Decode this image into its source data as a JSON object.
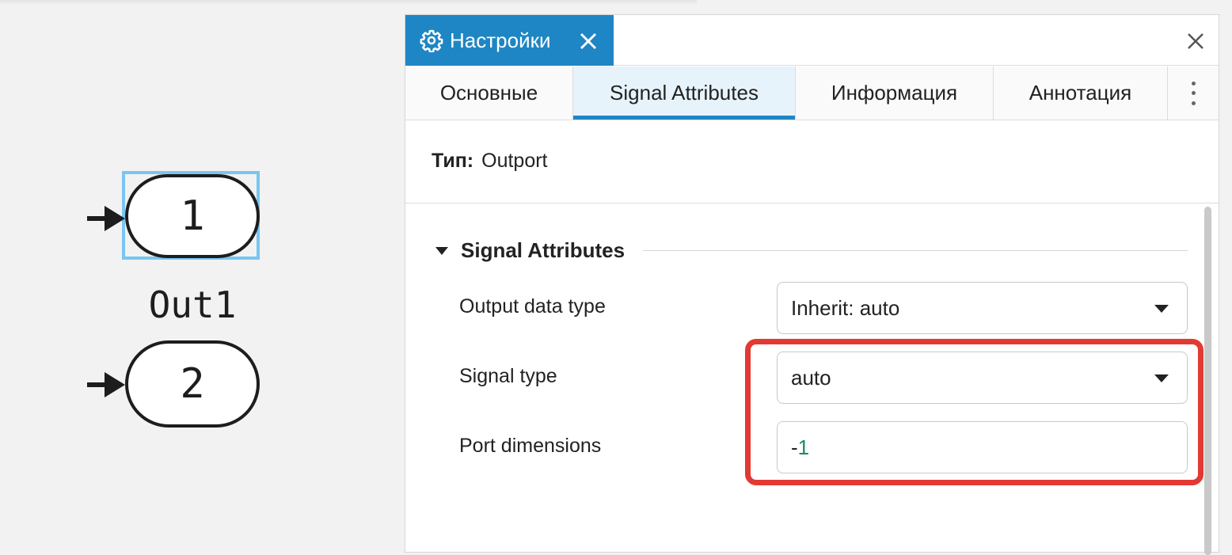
{
  "canvas": {
    "blocks": [
      {
        "number": "1",
        "selected": true
      },
      {
        "number": "2",
        "selected": false
      }
    ],
    "block_label": "Out1",
    "selection_color": "#79c6f0"
  },
  "panel": {
    "header_title": "Настройки",
    "header_icon": "gear-icon",
    "accent_color": "#1e86c4",
    "tabs": [
      {
        "label": "Основные",
        "active": false
      },
      {
        "label": "Signal Attributes",
        "active": true
      },
      {
        "label": "Информация",
        "active": false
      },
      {
        "label": "Аннотация",
        "active": false
      }
    ],
    "type_label": "Тип:",
    "type_value": "Outport",
    "section_title": "Signal Attributes",
    "fields": {
      "output_data_type": {
        "label": "Output data type",
        "value": "Inherit: auto"
      },
      "signal_type": {
        "label": "Signal type",
        "value": "auto"
      },
      "port_dimensions": {
        "label": "Port dimensions",
        "value_sign": "-",
        "value_number": "1"
      }
    },
    "highlight_color": "#e23a33"
  }
}
